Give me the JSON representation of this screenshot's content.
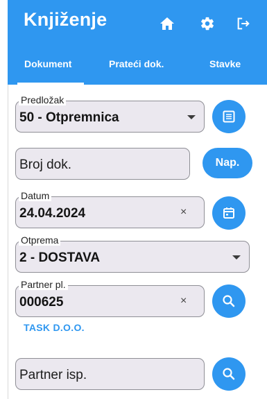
{
  "app": {
    "title": "Knjiženje"
  },
  "header_icons": [
    "home-icon",
    "gear-icon",
    "logout-icon"
  ],
  "tabs": [
    {
      "label": "Dokument",
      "active": true
    },
    {
      "label": "Prateći dok.",
      "active": false
    },
    {
      "label": "Stavke",
      "active": false
    }
  ],
  "form": {
    "predlozak": {
      "label": "Predložak",
      "value": "50 - Otpremnica"
    },
    "broj_dok": {
      "placeholder": "Broj dok."
    },
    "nap_button": "Nap.",
    "datum": {
      "label": "Datum",
      "value": "24.04.2024"
    },
    "otprema": {
      "label": "Otprema",
      "value": "2 - DOSTAVA"
    },
    "partner_pl": {
      "label": "Partner pl.",
      "value": "000625",
      "name": "TASK D.O.O."
    },
    "partner_isp": {
      "placeholder": "Partner isp."
    }
  },
  "clear_symbol": "×",
  "colors": {
    "primary": "#2f97f0",
    "field_bg": "#ebe8ef",
    "field_border": "#8e8e95"
  }
}
